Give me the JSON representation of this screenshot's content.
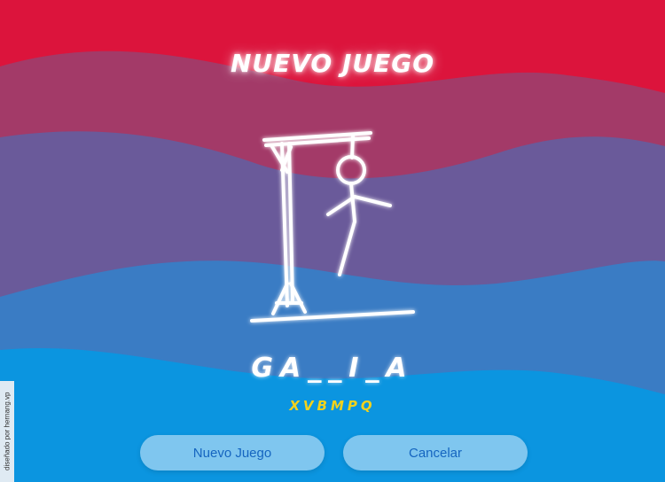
{
  "title": "NUEVO JUEGO",
  "word": "GA__I_A",
  "wrong_letters": "XVBMPQ",
  "buttons": {
    "new_game": "Nuevo Juego",
    "cancel": "Cancelar"
  },
  "credit": "diseñado por hernang.vp",
  "colors": {
    "top": "#dc143c",
    "band2": "#a33a68",
    "band3": "#6a5a9a",
    "band4": "#3a7cc4",
    "bottom": "#0b95e0",
    "wrong_letters": "#f2d21c"
  },
  "hangman_stage": 4
}
